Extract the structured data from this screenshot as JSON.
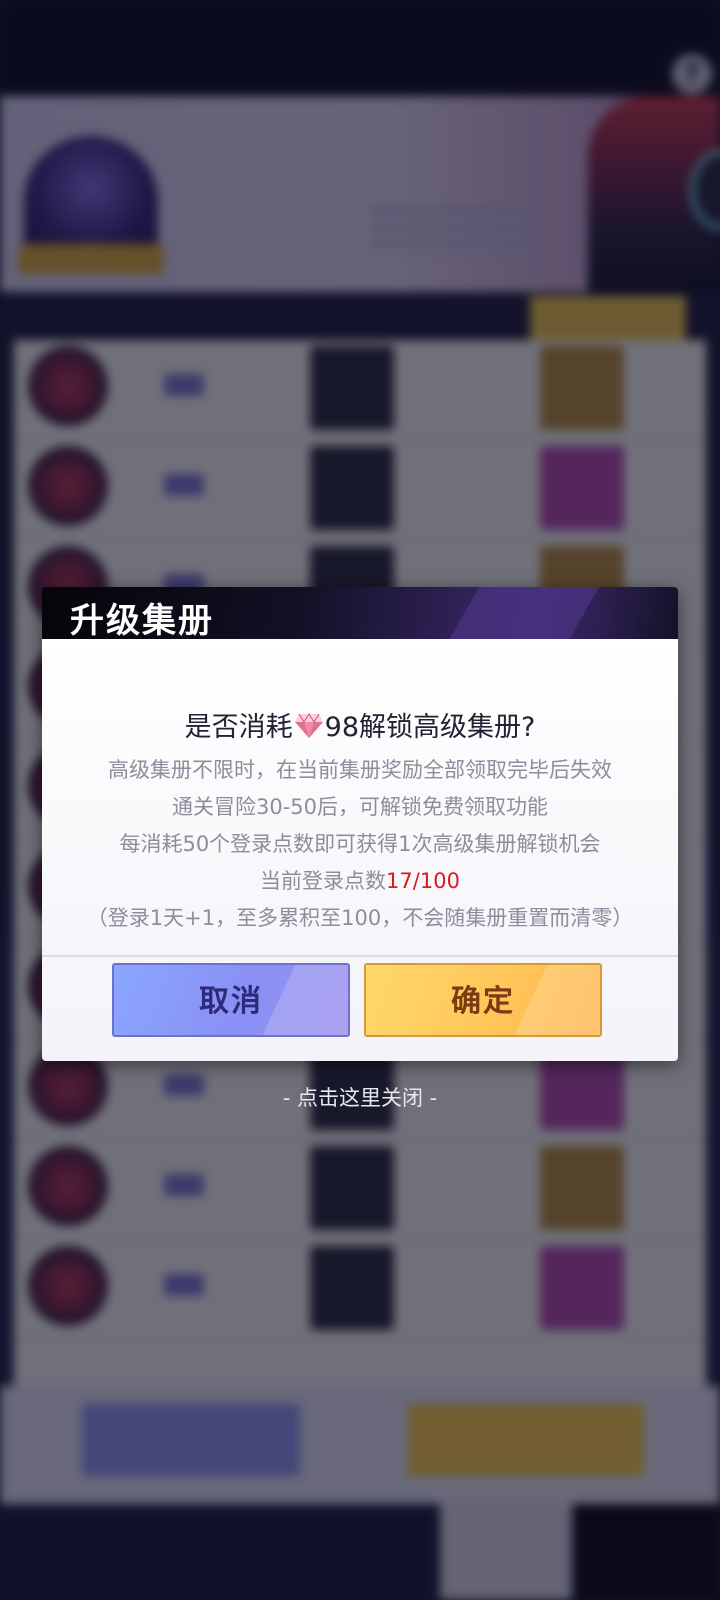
{
  "dialog": {
    "title": "升级集册",
    "question_prefix": "是否消耗",
    "cost": "98",
    "question_suffix": "解锁高级集册?",
    "currency_icon": "diamond-gem-icon",
    "info_lines": [
      "高级集册不限时，在当前集册奖励全部领取完毕后失效",
      "通关冒险30-50后，可解锁免费领取功能",
      "每消耗50个登录点数即可获得1次高级集册解锁机会"
    ],
    "points_label": "当前登录点数",
    "points_value": "17/100",
    "points_note": "（登录1天+1，至多累积至100，不会随集册重置而清零）",
    "cancel_label": "取消",
    "confirm_label": "确定"
  },
  "close_hint": "- 点击这里关闭 -",
  "colors": {
    "points_value": "#d81b1b",
    "cancel_button": "#8a90f4",
    "confirm_button": "#ffc65a"
  }
}
